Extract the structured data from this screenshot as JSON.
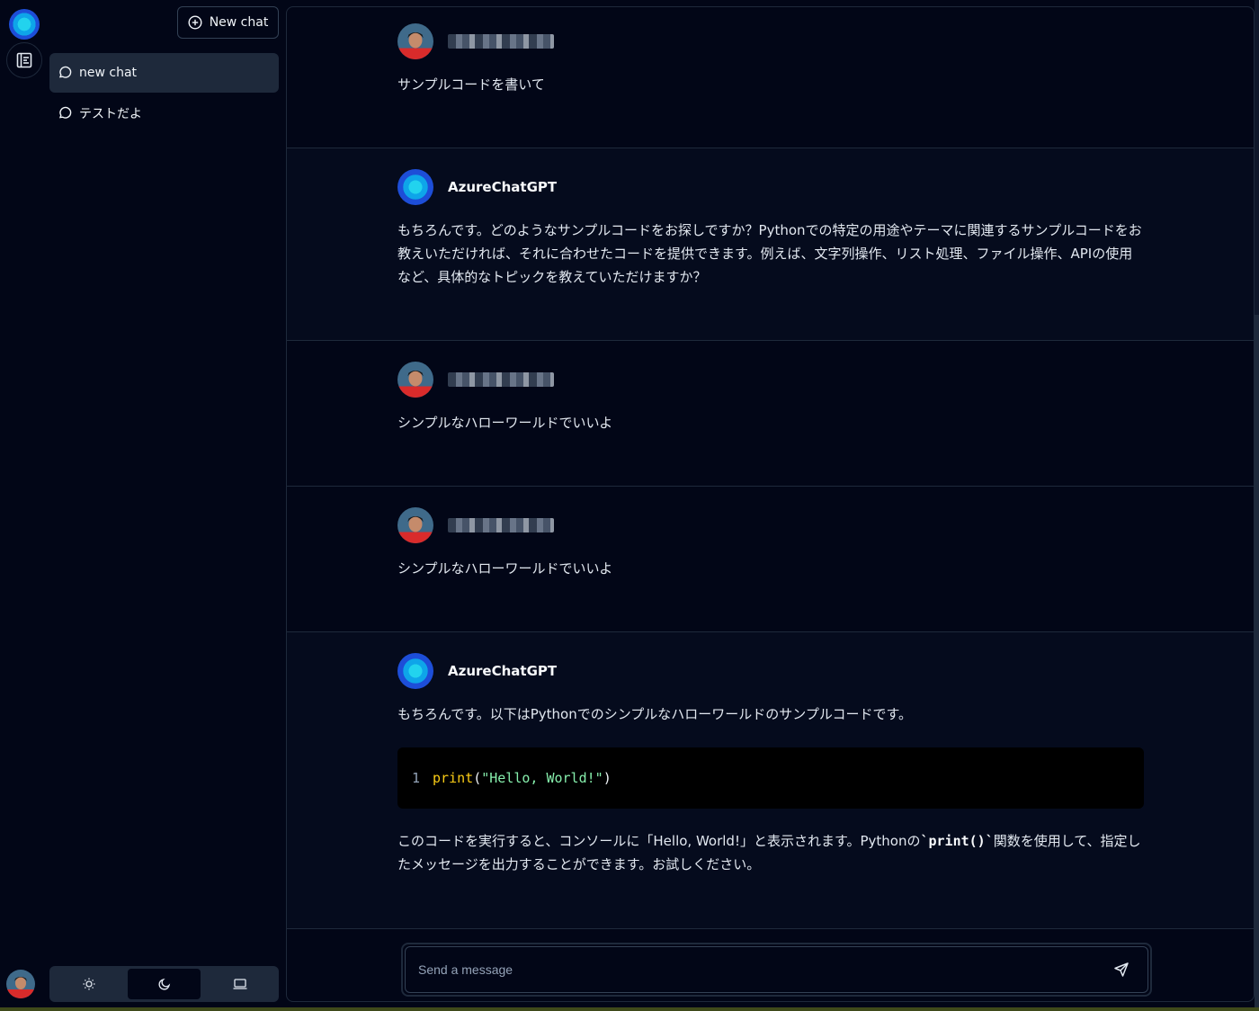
{
  "sidebar": {
    "new_chat_label": "New chat",
    "chats": [
      {
        "label": "new chat",
        "active": true
      },
      {
        "label": "テストだよ",
        "active": false
      }
    ]
  },
  "messages": [
    {
      "role": "user",
      "text": "サンプルコードを書いて"
    },
    {
      "role": "assistant",
      "name": "AzureChatGPT",
      "text": "もちろんです。どのようなサンプルコードをお探しですか？Pythonでの特定の用途やテーマに関連するサンプルコードをお教えいただければ、それに合わせたコードを提供できます。例えば、文字列操作、リスト処理、ファイル操作、APIの使用など、具体的なトピックを教えていただけますか？"
    },
    {
      "role": "user",
      "text": "シンプルなハローワールドでいいよ"
    },
    {
      "role": "user",
      "text": "シンプルなハローワールドでいいよ"
    },
    {
      "role": "assistant",
      "name": "AzureChatGPT",
      "intro": "もちろんです。以下はPythonでのシンプルなハローワールドのサンプルコードです。",
      "code": {
        "line_number": "1",
        "fn": "print",
        "open": "(",
        "string": "\"Hello, World!\"",
        "close": ")"
      },
      "outro_before": "このコードを実行すると、コンソールに「Hello, World!」と表示されます。Pythonの",
      "outro_code": "`print()`",
      "outro_after": "関数を使用して、指定したメッセージを出力することができます。お試しください。"
    }
  ],
  "input": {
    "placeholder": "Send a message"
  },
  "colors": {
    "background": "#020617",
    "panel_border": "#1e293b",
    "active_item": "#1e293b",
    "accent": "#0ea5e9"
  },
  "icons": [
    "app-logo-icon",
    "sidebar-toggle-icon",
    "plus-circle-icon",
    "chat-bubble-icon",
    "sun-icon",
    "moon-icon",
    "laptop-icon",
    "send-icon"
  ]
}
